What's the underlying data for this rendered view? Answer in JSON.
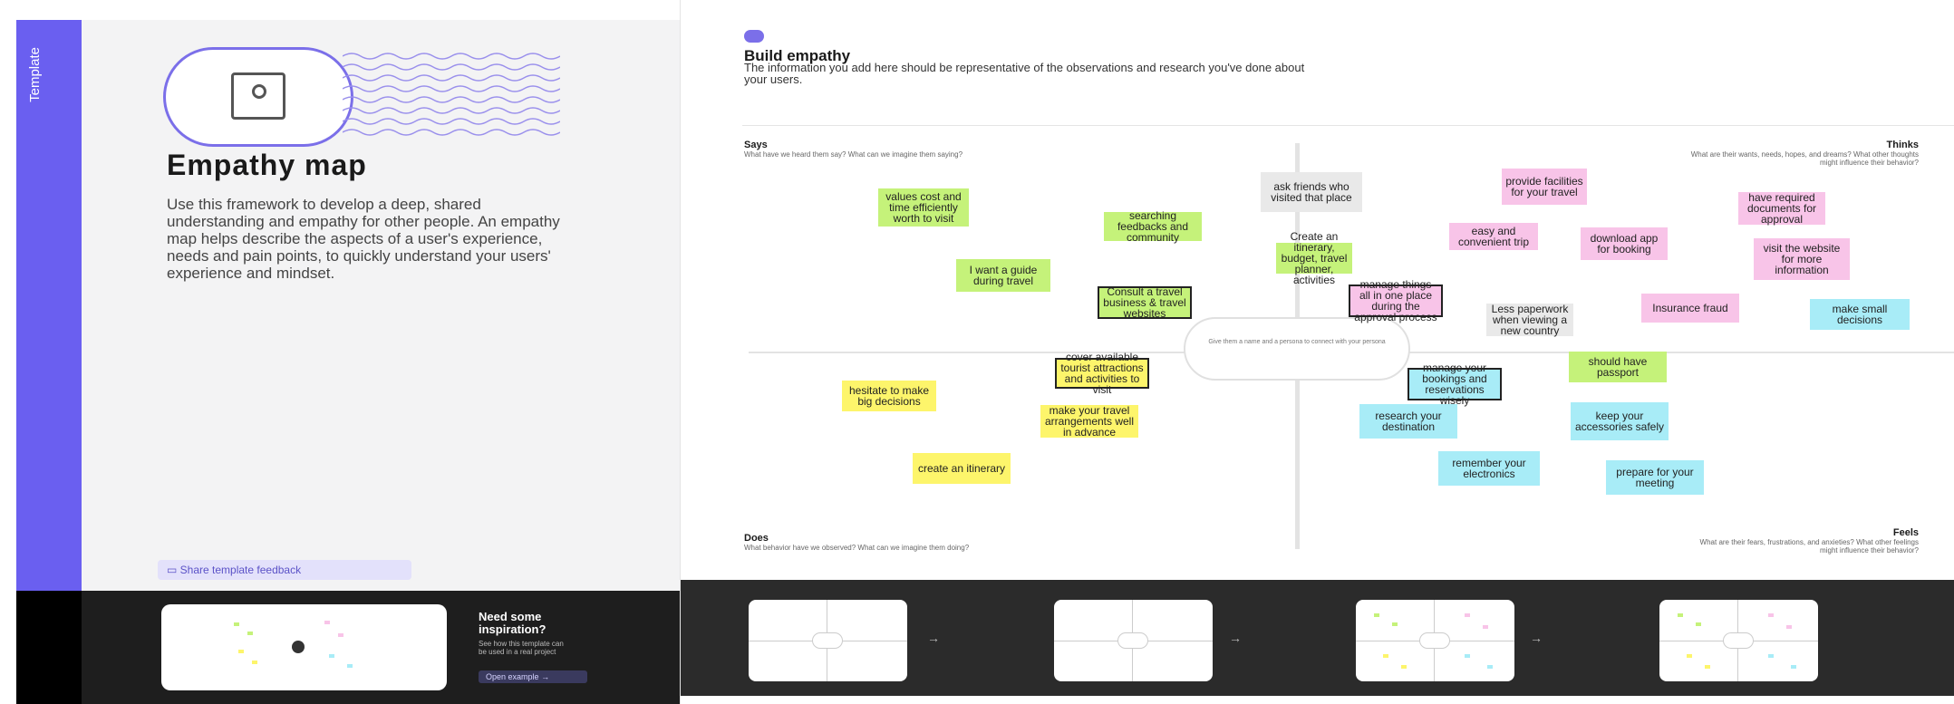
{
  "side": {
    "label": "Template"
  },
  "intro": {
    "title": "Empathy map",
    "description": "Use this framework to develop a deep, shared understanding and empathy for other people. An empathy map helps describe the aspects of a user's experience, needs and pain points, to quickly understand your users' experience and mindset.",
    "feedback_label": "Share template feedback"
  },
  "inspiration": {
    "title": "Need some inspiration?",
    "text": "See how this template can be used in a real project",
    "button_label": "Open example"
  },
  "board": {
    "title": "Build empathy",
    "subtitle": "The information you add here should be representative of the observations and research you've done about your users.",
    "center_text": "Give them a name and a persona to connect with your persona",
    "quadrants": {
      "says": {
        "label": "Says",
        "sub": "What have we heard them say? What can we imagine them saying?"
      },
      "thinks": {
        "label": "Thinks",
        "sub": "What are their wants, needs, hopes, and dreams? What other thoughts might influence their behavior?"
      },
      "does": {
        "label": "Does",
        "sub": "What behavior have we observed? What can we imagine them doing?"
      },
      "feels": {
        "label": "Feels",
        "sub": "What are their fears, frustrations, and anxieties? What other feelings might influence their behavior?"
      }
    },
    "notes": [
      {
        "text": "values cost and time efficiently worth to visit",
        "color": "green"
      },
      {
        "text": "searching feedbacks and community",
        "color": "green"
      },
      {
        "text": "I want a guide during travel",
        "color": "green"
      },
      {
        "text": "Consult a travel business & travel websites",
        "color": "green"
      },
      {
        "text": "ask friends who visited that place",
        "color": "gray"
      },
      {
        "text": "Create an itinerary, budget, travel planner, activities",
        "color": "green"
      },
      {
        "text": "provide facilities for your travel",
        "color": "pink"
      },
      {
        "text": "easy and convenient trip",
        "color": "pink"
      },
      {
        "text": "download app for booking",
        "color": "pink"
      },
      {
        "text": "have required documents for approval",
        "color": "pink"
      },
      {
        "text": "visit the website for more information",
        "color": "pink"
      },
      {
        "text": "manage things all in one place during the approval process",
        "color": "pink"
      },
      {
        "text": "Less paperwork when viewing a new country",
        "color": "gray"
      },
      {
        "text": "Insurance fraud",
        "color": "pink"
      },
      {
        "text": "make small decisions",
        "color": "cyan"
      },
      {
        "text": "cover available tourist attractions and activities to visit",
        "color": "yellow"
      },
      {
        "text": "hesitate to make big decisions",
        "color": "yellow"
      },
      {
        "text": "make your travel arrangements well in advance",
        "color": "yellow"
      },
      {
        "text": "create an itinerary",
        "color": "yellow"
      },
      {
        "text": "should have passport",
        "color": "green"
      },
      {
        "text": "manage your bookings and reservations wisely",
        "color": "cyan"
      },
      {
        "text": "research your destination",
        "color": "cyan"
      },
      {
        "text": "keep your accessories safely",
        "color": "cyan"
      },
      {
        "text": "remember your electronics",
        "color": "cyan"
      },
      {
        "text": "prepare for your meeting",
        "color": "cyan"
      }
    ]
  },
  "colors": {
    "accent": "#6a5ff0",
    "green": "#c5f27a",
    "yellow": "#fdf56b",
    "pink": "#f8c4e8",
    "cyan": "#a8ecf7",
    "gray": "#e9e9e9"
  },
  "icons": {
    "hero": "person-card-icon",
    "feedback": "comment-icon",
    "arrow": "arrow-right-icon"
  }
}
